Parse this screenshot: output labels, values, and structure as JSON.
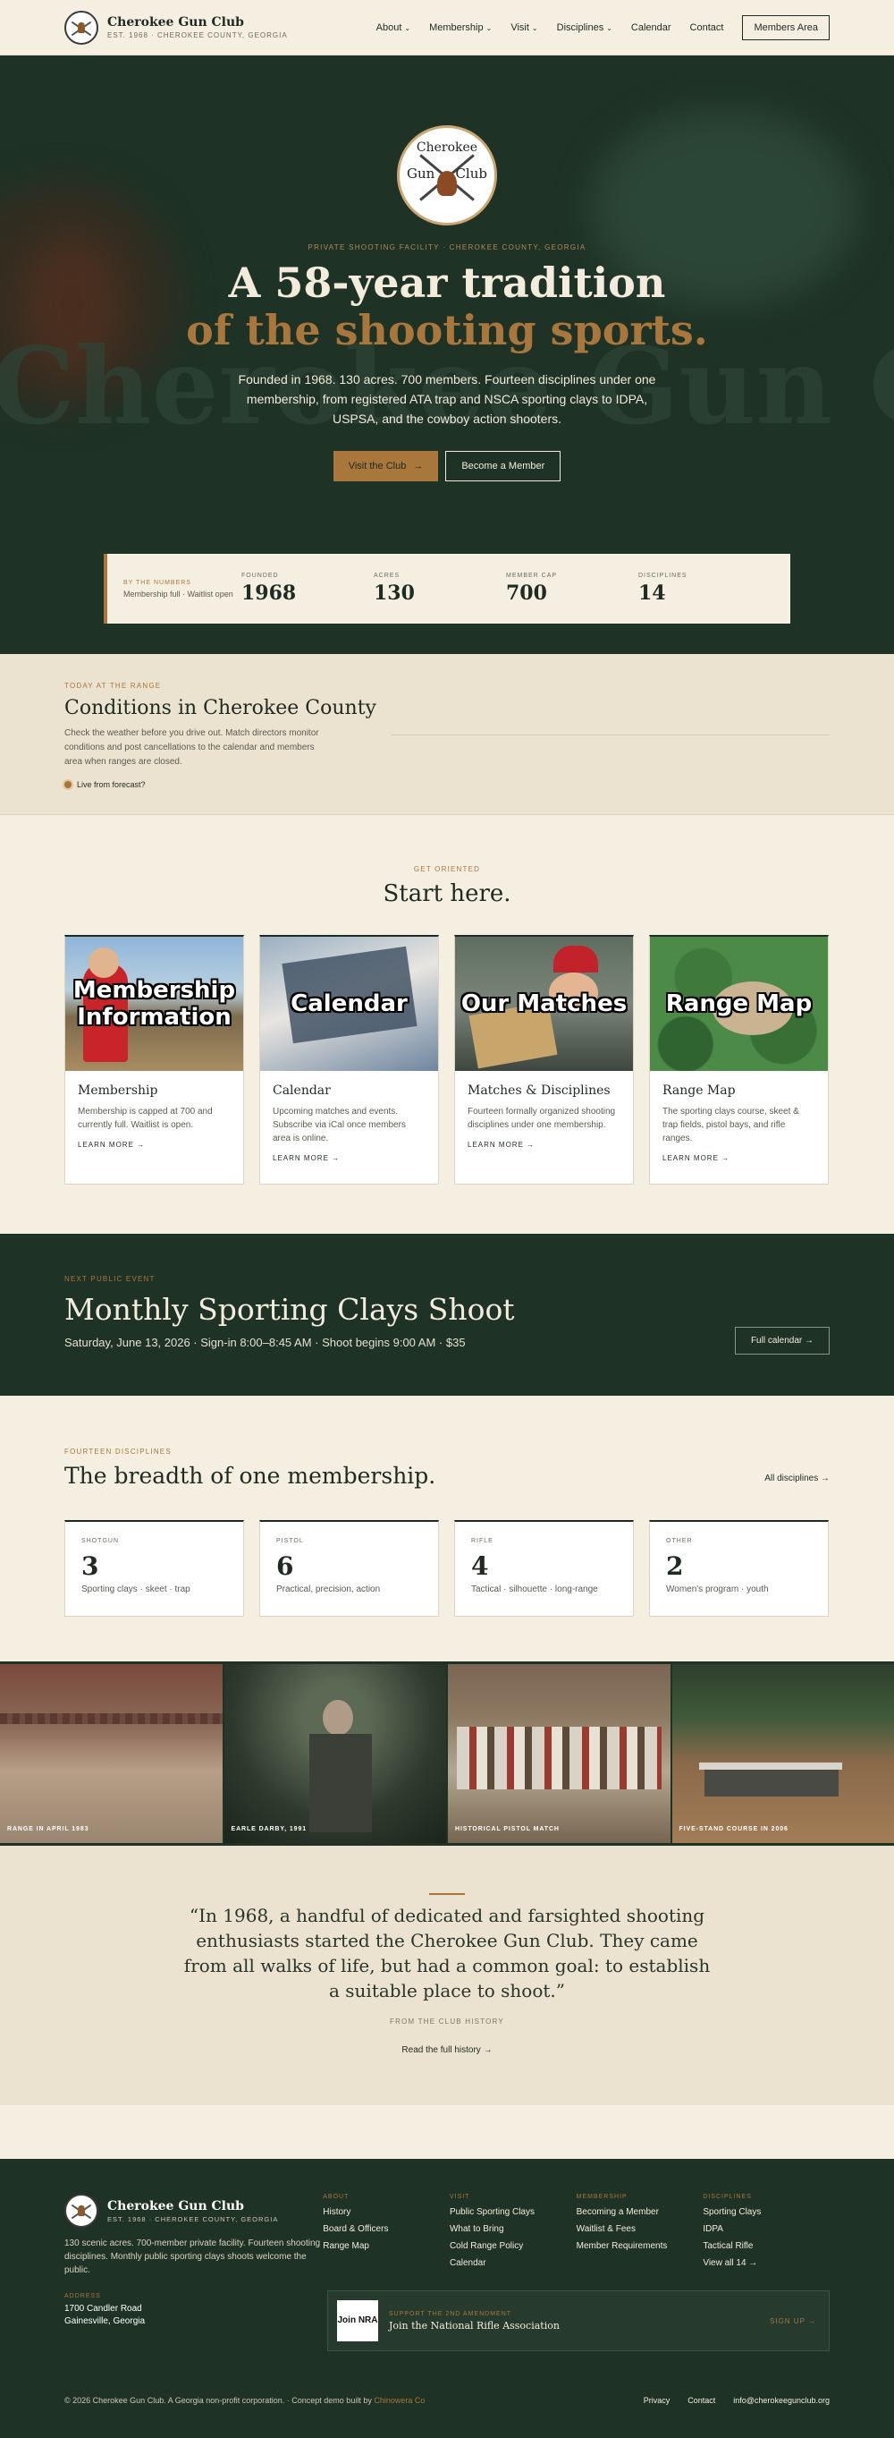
{
  "header": {
    "brand_name": "Cherokee Gun Club",
    "brand_sub": "EST. 1968 · CHEROKEE COUNTY, GEORGIA",
    "nav": [
      {
        "label": "About",
        "dropdown": true
      },
      {
        "label": "Membership",
        "dropdown": true
      },
      {
        "label": "Visit",
        "dropdown": true
      },
      {
        "label": "Disciplines",
        "dropdown": true
      },
      {
        "label": "Calendar",
        "dropdown": false
      },
      {
        "label": "Contact",
        "dropdown": false
      }
    ],
    "members_button": "Members Area"
  },
  "hero": {
    "seal_top": "Cherokee",
    "seal_left": "Gun",
    "seal_right": "Club",
    "eyebrow": "PRIVATE SHOOTING FACILITY · CHEROKEE COUNTY, GEORGIA",
    "title_line1": "A 58-year tradition",
    "title_line2": "of the shooting sports.",
    "paragraph": "Founded in 1968. 130 acres. 700 members. Fourteen disciplines under one membership, from registered ATA trap and NSCA sporting clays to IDPA, USPSA, and the cowboy action shooters.",
    "btn_visit": "Visit the Club",
    "btn_member": "Become a Member",
    "bg_text": "Cherokee Gun Club"
  },
  "stats": {
    "eyebrow": "BY THE NUMBERS",
    "sub": "Membership full · Waitlist open",
    "items": [
      {
        "label": "FOUNDED",
        "value": "1968"
      },
      {
        "label": "ACRES",
        "value": "130"
      },
      {
        "label": "MEMBER CAP",
        "value": "700"
      },
      {
        "label": "DISCIPLINES",
        "value": "14"
      }
    ]
  },
  "conditions": {
    "eyebrow": "TODAY AT THE RANGE",
    "title": "Conditions in Cherokee County",
    "text": "Check the weather before you drive out. Match directors monitor conditions and post cancellations to the calendar and members area when ranges are closed.",
    "live": "Live from forecast?"
  },
  "start": {
    "eyebrow": "GET ORIENTED",
    "title": "Start here.",
    "cards": [
      {
        "img_label": "Membership Information",
        "title": "Membership",
        "text": "Membership is capped at 700 and currently full. Waitlist is open.",
        "more": "LEARN MORE"
      },
      {
        "img_label": "Calendar",
        "title": "Calendar",
        "text": "Upcoming matches and events. Subscribe via iCal once members area is online.",
        "more": "LEARN MORE"
      },
      {
        "img_label": "Our Matches",
        "title": "Matches & Disciplines",
        "text": "Fourteen formally organized shooting disciplines under one membership.",
        "more": "LEARN MORE"
      },
      {
        "img_label": "Range Map",
        "title": "Range Map",
        "text": "The sporting clays course, skeet & trap fields, pistol bays, and rifle ranges.",
        "more": "LEARN MORE"
      }
    ]
  },
  "event": {
    "eyebrow": "NEXT PUBLIC EVENT",
    "title": "Monthly Sporting Clays Shoot",
    "meta": "Saturday, June 13, 2026 · Sign-in 8:00–8:45 AM · Shoot begins 9:00 AM · $35",
    "button": "Full calendar"
  },
  "disciplines": {
    "eyebrow": "FOURTEEN DISCIPLINES",
    "title": "The breadth of one membership.",
    "all_link": "All disciplines",
    "cards": [
      {
        "label": "SHOTGUN",
        "count": "3",
        "desc": "Sporting clays · skeet · trap"
      },
      {
        "label": "PISTOL",
        "count": "6",
        "desc": "Practical, precision, action"
      },
      {
        "label": "RIFLE",
        "count": "4",
        "desc": "Tactical · silhouette · long-range"
      },
      {
        "label": "OTHER",
        "count": "2",
        "desc": "Women's program · youth"
      }
    ]
  },
  "photos": [
    {
      "caption": "RANGE IN APRIL 1983"
    },
    {
      "caption": "EARLE DARBY, 1991"
    },
    {
      "caption": "HISTORICAL PISTOL MATCH"
    },
    {
      "caption": "FIVE-STAND COURSE IN 2006"
    }
  ],
  "quote": {
    "text": "“In 1968, a handful of dedicated and farsighted shooting enthusiasts started the Cherokee Gun Club. They came from all walks of life, but had a common goal: to establish a suitable place to shoot.”",
    "source": "FROM THE CLUB HISTORY",
    "link": "Read the full history"
  },
  "footer": {
    "brand_name": "Cherokee Gun Club",
    "brand_sub": "EST. 1968 · CHEROKEE COUNTY, GEORGIA",
    "description": "130 scenic acres. 700-member private facility. Fourteen shooting disciplines. Monthly public sporting clays shoots welcome the public.",
    "address_label": "ADDRESS",
    "address_line1": "1700 Candler Road",
    "address_line2": "Gainesville, Georgia",
    "columns": [
      {
        "heading": "ABOUT",
        "links": [
          "History",
          "Board & Officers",
          "Range Map"
        ]
      },
      {
        "heading": "VISIT",
        "links": [
          "Public Sporting Clays",
          "What to Bring",
          "Cold Range Policy",
          "Calendar"
        ]
      },
      {
        "heading": "MEMBERSHIP",
        "links": [
          "Becoming a Member",
          "Waitlist & Fees",
          "Member Requirements"
        ]
      },
      {
        "heading": "DISCIPLINES",
        "links": [
          "Sporting Clays",
          "IDPA",
          "Tactical Rifle",
          "View all 14 →"
        ]
      }
    ],
    "nra_logo": "Join NRA",
    "nra_eyebrow": "SUPPORT THE 2ND AMENDMENT",
    "nra_text": "Join the National Rifle Association",
    "nra_signup": "SIGN UP →",
    "copyright": "© 2026 Cherokee Gun Club. A Georgia non-profit corporation. · Concept demo built by ",
    "credit": "Chinowera Co",
    "bottom_links": [
      "Privacy",
      "Contact",
      "info@cherokeegunclub.org"
    ]
  }
}
